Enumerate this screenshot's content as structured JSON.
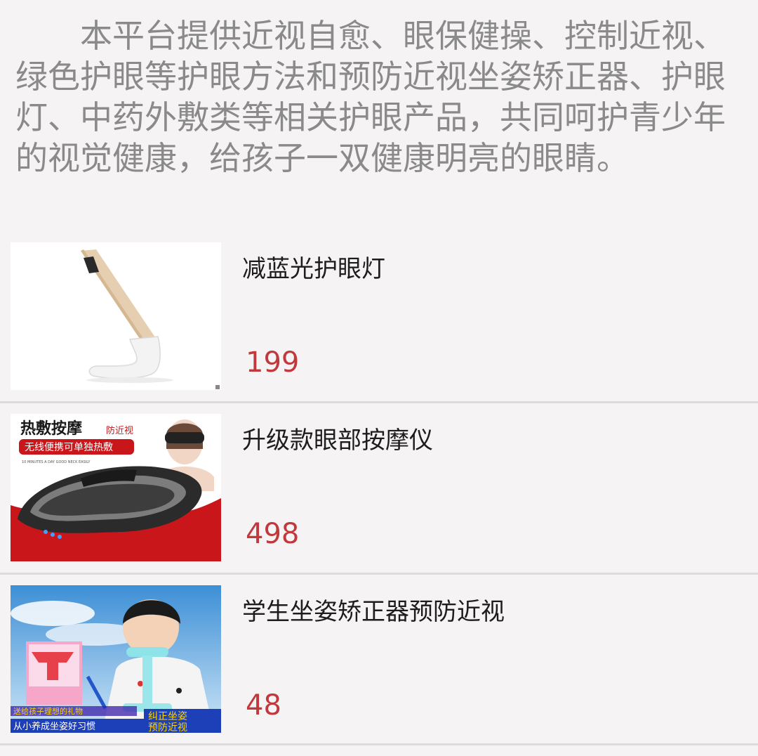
{
  "intro": {
    "text": "本平台提供近视自愈、眼保健操、控制近视、绿色护眼等护眼方法和预防近视坐姿矫正器、护眼灯、中药外敷类等相关护眼产品，共同呵护青少年的视觉健康，给孩子一双健康明亮的眼睛。"
  },
  "products": [
    {
      "title": "减蓝光护眼灯",
      "price": "199",
      "image_icon": "desk-lamp-image"
    },
    {
      "title": "升级款眼部按摩仪",
      "price": "498",
      "image_icon": "eye-massager-image",
      "image_text": {
        "headline": "热敷按摩",
        "tag": "防近视",
        "banner": "无线便携可单独热敷",
        "small": "10 MINUTES A DAY GOOD NECK EASILY"
      }
    },
    {
      "title": "学生坐姿矫正器预防近视",
      "price": "48",
      "image_icon": "posture-corrector-image",
      "image_text": {
        "gift": "送给孩子理想的礼物",
        "habit": "从小养成坐姿好习惯",
        "badge_line1": "纠正坐姿",
        "badge_line2": "预防近视"
      }
    }
  ],
  "colors": {
    "background": "#f5f3f4",
    "intro_text": "#8a8a8a",
    "title_text": "#1d1d1d",
    "price_text": "#c0393c",
    "divider": "#dcdcdc"
  }
}
